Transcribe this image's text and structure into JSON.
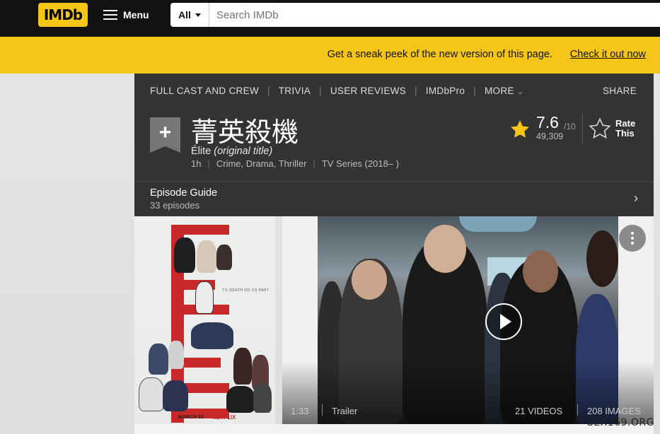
{
  "header": {
    "logo": "IMDb",
    "menu_label": "Menu",
    "search_category": "All",
    "search_placeholder": "Search IMDb"
  },
  "promo": {
    "text": "Get a sneak peek of the new version of this page.",
    "link": "Check it out now"
  },
  "subnav": {
    "items": [
      "FULL CAST AND CREW",
      "TRIVIA",
      "USER REVIEWS",
      "IMDbPro",
      "MORE"
    ],
    "share": "SHARE"
  },
  "title": {
    "name": "菁英殺機",
    "original_name": "Élite",
    "original_suffix": "(original title)",
    "runtime": "1h",
    "genres": "Crime, Drama, Thriller",
    "type": "TV Series (2018– )",
    "add_icon": "plus-icon"
  },
  "rating": {
    "value": "7.6",
    "max": "/10",
    "count": "49,309",
    "rate_label_1": "Rate",
    "rate_label_2": "This",
    "colors": {
      "star": "#f5c518"
    }
  },
  "episodes": {
    "label": "Episode Guide",
    "count": "33 episodes"
  },
  "poster": {
    "tagline": "TIL DEATH DO US PART",
    "date": "MARCH 13",
    "brand": "NETFLIX"
  },
  "video": {
    "duration": "1:33",
    "label": "Trailer",
    "videos": "21 VIDEOS",
    "images": "208 IMAGES"
  },
  "watermark": "SEX169.ORG",
  "colors": {
    "brand": "#f5c518",
    "dark": "#121212",
    "panel": "#333333"
  }
}
